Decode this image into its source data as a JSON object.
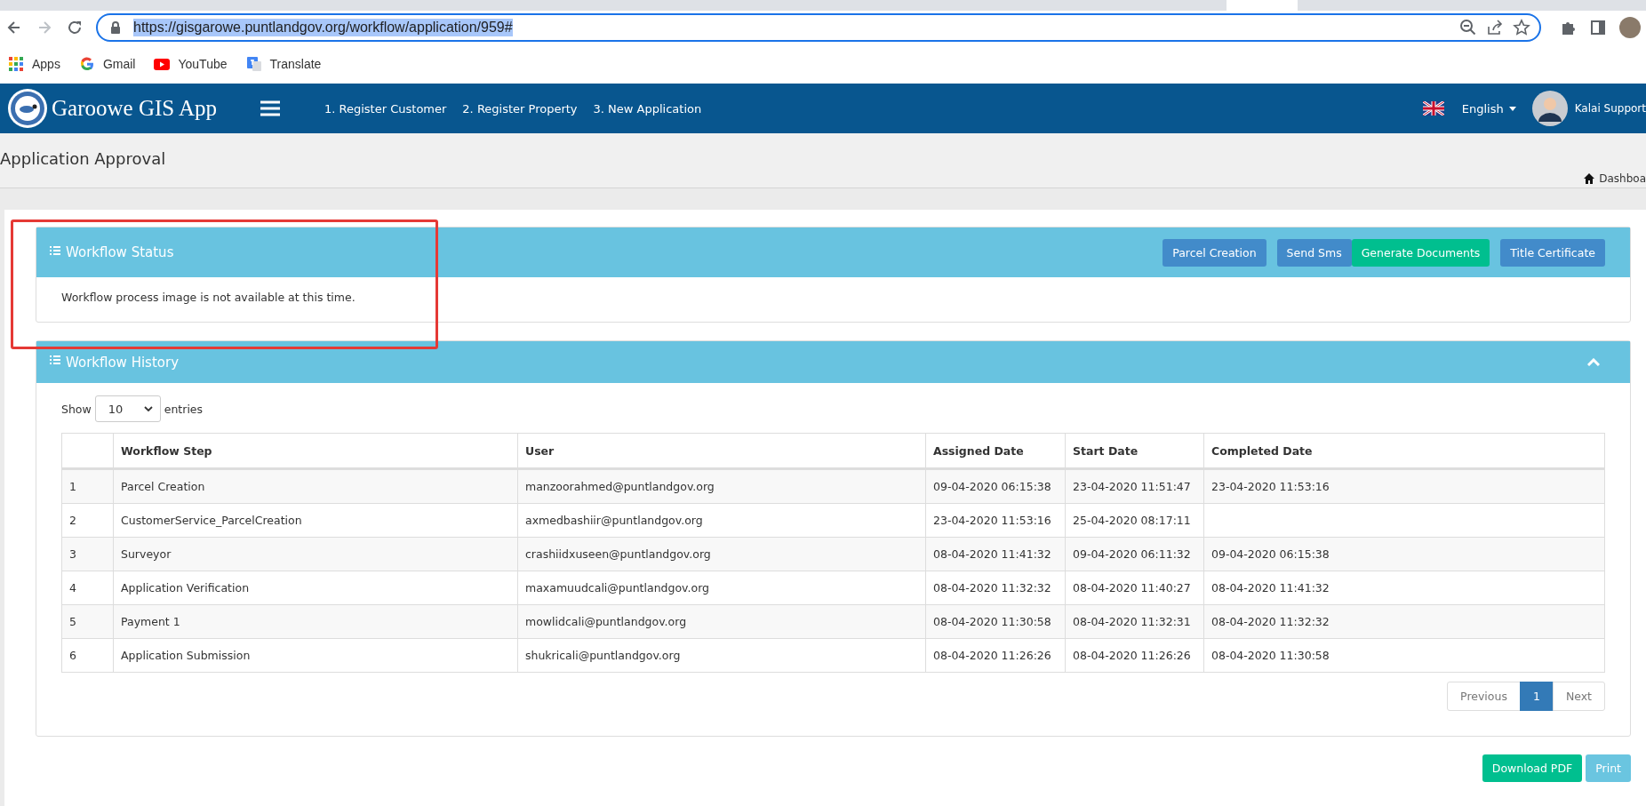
{
  "browser": {
    "url": "https://gisgarowe.puntlandgov.org/workflow/application/959#",
    "url_selected": true,
    "bookmarks": [
      {
        "label": "Apps",
        "kind": "apps"
      },
      {
        "label": "Gmail",
        "kind": "google"
      },
      {
        "label": "YouTube",
        "kind": "youtube"
      },
      {
        "label": "Translate",
        "kind": "translate"
      }
    ]
  },
  "navbar": {
    "app_title": "Garoowe GIS App",
    "links": [
      "1. Register Customer",
      "2. Register Property",
      "3. New Application"
    ],
    "language": "English",
    "user_name": "Kalai Support"
  },
  "page_header": {
    "title": "Application Approval",
    "breadcrumb": "Dashboa"
  },
  "workflow_status": {
    "title": "Workflow Status",
    "buttons": [
      {
        "label": "Parcel Creation",
        "kind": "primary"
      },
      {
        "label": "Send Sms",
        "kind": "primary"
      },
      {
        "label": "Generate Documents",
        "kind": "success"
      },
      {
        "label": "Title Certificate",
        "kind": "primary"
      }
    ],
    "message": "Workflow process image is not available at this time."
  },
  "workflow_history": {
    "title": "Workflow History",
    "expanded": true,
    "length_menu": {
      "prefix": "Show",
      "value": "10",
      "suffix": "entries"
    },
    "table": {
      "columns": [
        "Workflow Step",
        "User",
        "Assigned Date",
        "Start Date",
        "Completed Date"
      ],
      "rows": [
        {
          "number": "1",
          "cells": [
            "Parcel Creation",
            "manzoorahmed@puntlandgov.org",
            "09-04-2020 06:15:38",
            "23-04-2020 11:51:47",
            "23-04-2020 11:53:16"
          ]
        },
        {
          "number": "2",
          "cells": [
            "CustomerService_ParcelCreation",
            "axmedbashiir@puntlandgov.org",
            "23-04-2020 11:53:16",
            "25-04-2020 08:17:11",
            null
          ]
        },
        {
          "number": "3",
          "cells": [
            "Surveyor",
            "crashiidxuseen@puntlandgov.org",
            "08-04-2020 11:41:32",
            "09-04-2020 06:11:32",
            "09-04-2020 06:15:38"
          ]
        },
        {
          "number": "4",
          "cells": [
            "Application Verification",
            "maxamuudcali@puntlandgov.org",
            "08-04-2020 11:32:32",
            "08-04-2020 11:40:27",
            "08-04-2020 11:41:32"
          ]
        },
        {
          "number": "5",
          "cells": [
            "Payment 1",
            "mowlidcali@puntlandgov.org",
            "08-04-2020 11:30:58",
            "08-04-2020 11:32:31",
            "08-04-2020 11:32:32"
          ]
        },
        {
          "number": "6",
          "cells": [
            "Application Submission",
            "shukricali@puntlandgov.org",
            "08-04-2020 11:26:26",
            "08-04-2020 11:26:26",
            "08-04-2020 11:30:58"
          ]
        }
      ]
    },
    "pagination": [
      {
        "label": "Previous",
        "selected": false
      },
      {
        "label": "1",
        "selected": true
      },
      {
        "label": "Next",
        "selected": false
      }
    ]
  },
  "actions": [
    {
      "label": "Download PDF",
      "kind": "success"
    },
    {
      "label": "Print",
      "kind": "info"
    }
  ]
}
